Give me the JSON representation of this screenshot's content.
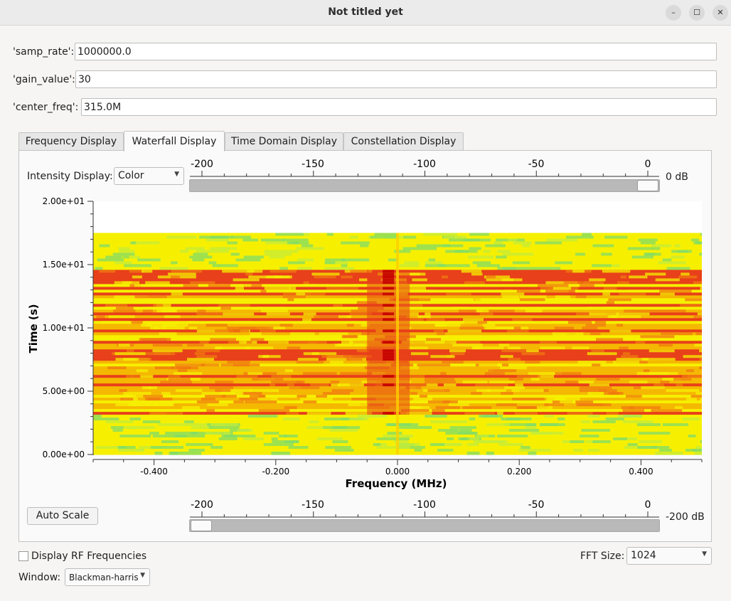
{
  "window": {
    "title": "Not titled yet",
    "controls": {
      "minimize": "–",
      "maximize": "☐",
      "close": "✕"
    }
  },
  "params": [
    {
      "label": "'samp_rate':",
      "value": "1000000.0"
    },
    {
      "label": "'gain_value':",
      "value": "30"
    },
    {
      "label": "'center_freq':",
      "value": "315.0M"
    }
  ],
  "tabs": [
    {
      "label": "Frequency Display",
      "active": false
    },
    {
      "label": "Waterfall Display",
      "active": true
    },
    {
      "label": "Time Domain Display",
      "active": false
    },
    {
      "label": "Constellation Display",
      "active": false
    }
  ],
  "waterfall": {
    "intensity_label": "Intensity Display:",
    "intensity_value": "Color",
    "top_slider": {
      "ticks": [
        "-200",
        "-150",
        "-100",
        "-50",
        "0"
      ],
      "value_label": "0 dB",
      "value_db": 0
    },
    "bottom_slider": {
      "ticks": [
        "-200",
        "-150",
        "-100",
        "-50",
        "0"
      ],
      "value_label": "-200 dB",
      "value_db": -200
    },
    "auto_scale_label": "Auto Scale",
    "colors": {
      "low": "#7fdc6a",
      "mid": "#f6f000",
      "high": "#e8401a",
      "peak": "#c40000"
    }
  },
  "chart_data": {
    "type": "heatmap",
    "xlabel": "Frequency (MHz)",
    "ylabel": "Time (s)",
    "xlim": [
      -0.5,
      0.5
    ],
    "ylim": [
      0,
      20
    ],
    "x_ticks": [
      "-0.400",
      "-0.200",
      "0.000",
      "0.200",
      "0.400"
    ],
    "x_tick_values": [
      -0.4,
      -0.2,
      0.0,
      0.2,
      0.4
    ],
    "y_ticks": [
      "0.00e+00",
      "5.00e+00",
      "1.00e+01",
      "1.50e+01",
      "2.00e+01"
    ],
    "y_tick_values": [
      0,
      5,
      10,
      15,
      20
    ],
    "data_extent_time": [
      0,
      17.5
    ],
    "signal_center_mhz": -0.015,
    "signal_active_time": [
      3.2,
      14.8
    ]
  },
  "footer": {
    "rf_label": "Display RF Frequencies",
    "rf_checked": false,
    "fft_label": "FFT Size:",
    "fft_value": "1024",
    "window_label": "Window:",
    "window_value": "Blackman-harris"
  }
}
